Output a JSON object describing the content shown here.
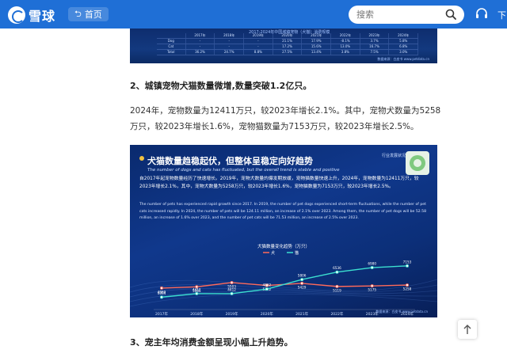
{
  "header": {
    "logo_text": "雪球",
    "home_label": "首页",
    "search_placeholder": "搜索",
    "nav_more": "下"
  },
  "top_image": {
    "title": "2017-2024年中国城镇宠物（犬猫）消费规模",
    "rows": [
      [
        "",
        "2017年",
        "2018年",
        "2019年",
        "2020年",
        "2021年",
        "2022年",
        "2023年",
        "2024年"
      ],
      [
        "Dog",
        "-",
        "-",
        "-",
        "21.1%",
        "17.9%",
        "-8.1%",
        "3.7%",
        "5.8%"
      ],
      [
        "Cat",
        "-",
        "-",
        "-",
        "17.2%",
        "15.6%",
        "13.0%",
        "16.7%",
        "6.8%"
      ],
      [
        "Total",
        "36.2%",
        "24.7%",
        "8.8%",
        "27.5%",
        "13.4%",
        "3.8%",
        "7.5%",
        "3.0%"
      ]
    ],
    "source": "数据来源：白皮书 www.petdata.cn"
  },
  "section2_heading": "2、城镇宠物犬猫数量微增,数量突破1.2亿只。",
  "section2_para": "2024年，宠物数量为12411万只，较2023年增长2.1%。其中，宠物犬数量为5258万只，较2023年增长1.6%，宠物猫数量为7153万只，较2023年增长2.5%。",
  "chart_image": {
    "title": "犬猫数量趋稳起伏，但整体呈稳定向好趋势",
    "subtitle": "The number of dogs and cats has fluctuated, but the overall trend is stable and positive",
    "tag": "行业发展状况",
    "cn_text": "自2017年起宠物数量经历了快速增长。2019年，宠物犬数量的爆发期放缓，宠物猫数量快速上升，2024年，宠物数量为12411万只，较2023年增长2.1%，其中，宠物犬数量为5258万只，较2023年增长1.6%，宠物猫数量为7153万只，较2023年增长2.5%。",
    "en_text": "The number of pets has experienced rapid growth since 2017. In 2019, the number of pet dogs experienced short-term fluctuations, while the number of pet cats increased rapidly. In 2024, the number of pets will be 124.11 million, an increase of 2.1% over 2023. Among them, the number of pet dogs will be 52.58 million, an increase of 1.6% over 2023, and the number of pet cats will be 71.53 million, an increase of 2.5% over 2023.",
    "source": "数据来源：白皮书 www.petdata.cn"
  },
  "chart_data": {
    "type": "line",
    "title": "犬猫数量变化趋势（万只）",
    "categories": [
      "2017年",
      "2018年",
      "2019年",
      "2020年",
      "2021年",
      "2022年",
      "2023年",
      "2024年"
    ],
    "series": [
      {
        "name": "犬",
        "color": "#ff6a5a",
        "values": [
          4960,
          5085,
          5503,
          5222,
          5429,
          5119,
          5175,
          5258
        ]
      },
      {
        "name": "猫",
        "color": "#3ce0d0",
        "values": [
          4064,
          4412,
          4412,
          4862,
          5806,
          6536,
          6980,
          7153
        ]
      }
    ],
    "ylim": [
      3000,
      8000
    ]
  },
  "section3_heading": "3、宠主年均消费金额呈现小幅上升趋势。",
  "colors": {
    "brand": "#1f6fd6",
    "chart_bg": "#0c2f79"
  }
}
